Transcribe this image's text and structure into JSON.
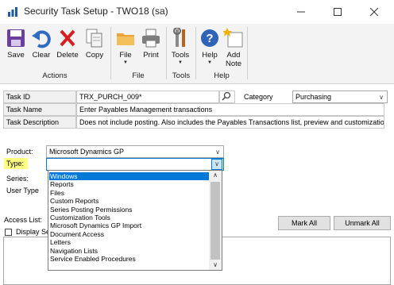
{
  "window": {
    "title": "Security Task Setup  -  TWO18 (sa)"
  },
  "ribbon": {
    "buttons": [
      {
        "label": "Save",
        "icon": "save-icon"
      },
      {
        "label": "Clear",
        "icon": "undo-icon"
      },
      {
        "label": "Delete",
        "icon": "delete-x-icon"
      },
      {
        "label": "Copy",
        "icon": "copy-icon"
      },
      {
        "label": "File",
        "icon": "folder-icon"
      },
      {
        "label": "Print",
        "icon": "printer-icon"
      },
      {
        "label": "Tools",
        "icon": "tools-icon"
      },
      {
        "label": "Help",
        "icon": "help-icon"
      },
      {
        "label": "Add",
        "label2": "Note",
        "icon": "note-icon"
      }
    ],
    "groups": [
      "Actions",
      "File",
      "Tools",
      "Help"
    ]
  },
  "task": {
    "id_label": "Task ID",
    "id_value": "TRX_PURCH_009*",
    "category_label": "Category",
    "category_value": "Purchasing",
    "name_label": "Task Name",
    "name_value": "Enter Payables Management transactions",
    "desc_label": "Task Description",
    "desc_value": "Does not include posting. Also includes the Payables Transactions list, preview and customization."
  },
  "filters": {
    "product_label": "Product:",
    "product_value": "Microsoft Dynamics GP",
    "type_label": "Type:",
    "type_value": "",
    "series_label": "Series:",
    "user_type_label": "User Type"
  },
  "type_options": [
    "Windows",
    "Reports",
    "Files",
    "Custom Reports",
    "Series Posting Permissions",
    "Customization Tools",
    "Microsoft Dynamics GP Import",
    "Document Access",
    "Letters",
    "Navigation Lists",
    "Service Enabled Procedures"
  ],
  "access": {
    "list_label": "Access List:",
    "display_label": "Display Se",
    "mark_all": "Mark All",
    "unmark_all": "Unmark All"
  },
  "colors": {
    "accent": "#0078d7",
    "type_highlight": "#ffff80"
  }
}
